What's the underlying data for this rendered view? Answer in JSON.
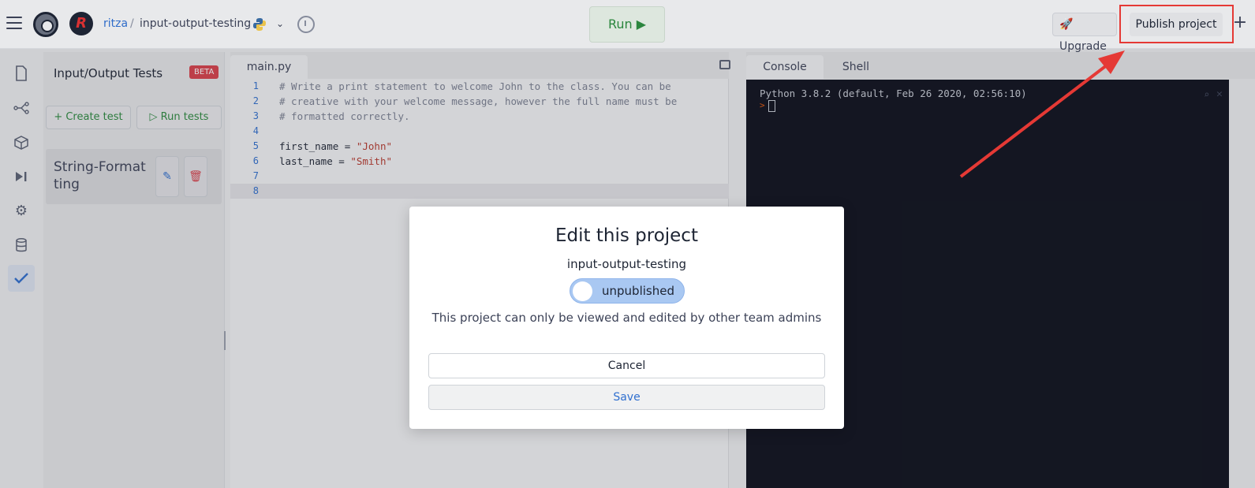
{
  "header": {
    "breadcrumb_user": "ritza",
    "breadcrumb_sep": "/",
    "breadcrumb_project": "input-output-testing",
    "run_label": "Run ▶",
    "upgrade_label": "Upgrade",
    "publish_label": "Publish project",
    "plus_label": "+"
  },
  "tests_panel": {
    "title": "Input/Output Tests",
    "badge": "BETA",
    "create_test": "+ Create test",
    "run_tests": "▷ Run tests",
    "tests": [
      {
        "name": "String-Formatting"
      }
    ]
  },
  "editor": {
    "tab": "main.py",
    "lines": [
      {
        "n": "1",
        "text": "# Write a print statement to welcome John to the class. You can be"
      },
      {
        "n": "2",
        "text": "# creative with your welcome message, however the full name must be"
      },
      {
        "n": "3",
        "text": "# formatted correctly."
      },
      {
        "n": "4",
        "text": ""
      },
      {
        "n": "5",
        "var": "first_name",
        "op": " = ",
        "str": "\"John\""
      },
      {
        "n": "6",
        "var": "last_name",
        "op": " = ",
        "str": "\"Smith\""
      },
      {
        "n": "7",
        "text": ""
      },
      {
        "n": "8",
        "text": ""
      }
    ]
  },
  "console": {
    "tabs": [
      "Console",
      "Shell"
    ],
    "output": "Python 3.8.2 (default, Feb 26 2020, 02:56:10)",
    "prompt": ">"
  },
  "modal": {
    "title": "Edit this project",
    "project_name": "input-output-testing",
    "toggle_label": "unpublished",
    "description": "This project can only be viewed and edited by other team admins",
    "cancel_label": "Cancel",
    "save_label": "Save"
  },
  "colors": {
    "annotation": "#e53935",
    "accent": "#2f6fcf",
    "run_green": "#2b8a3e"
  }
}
